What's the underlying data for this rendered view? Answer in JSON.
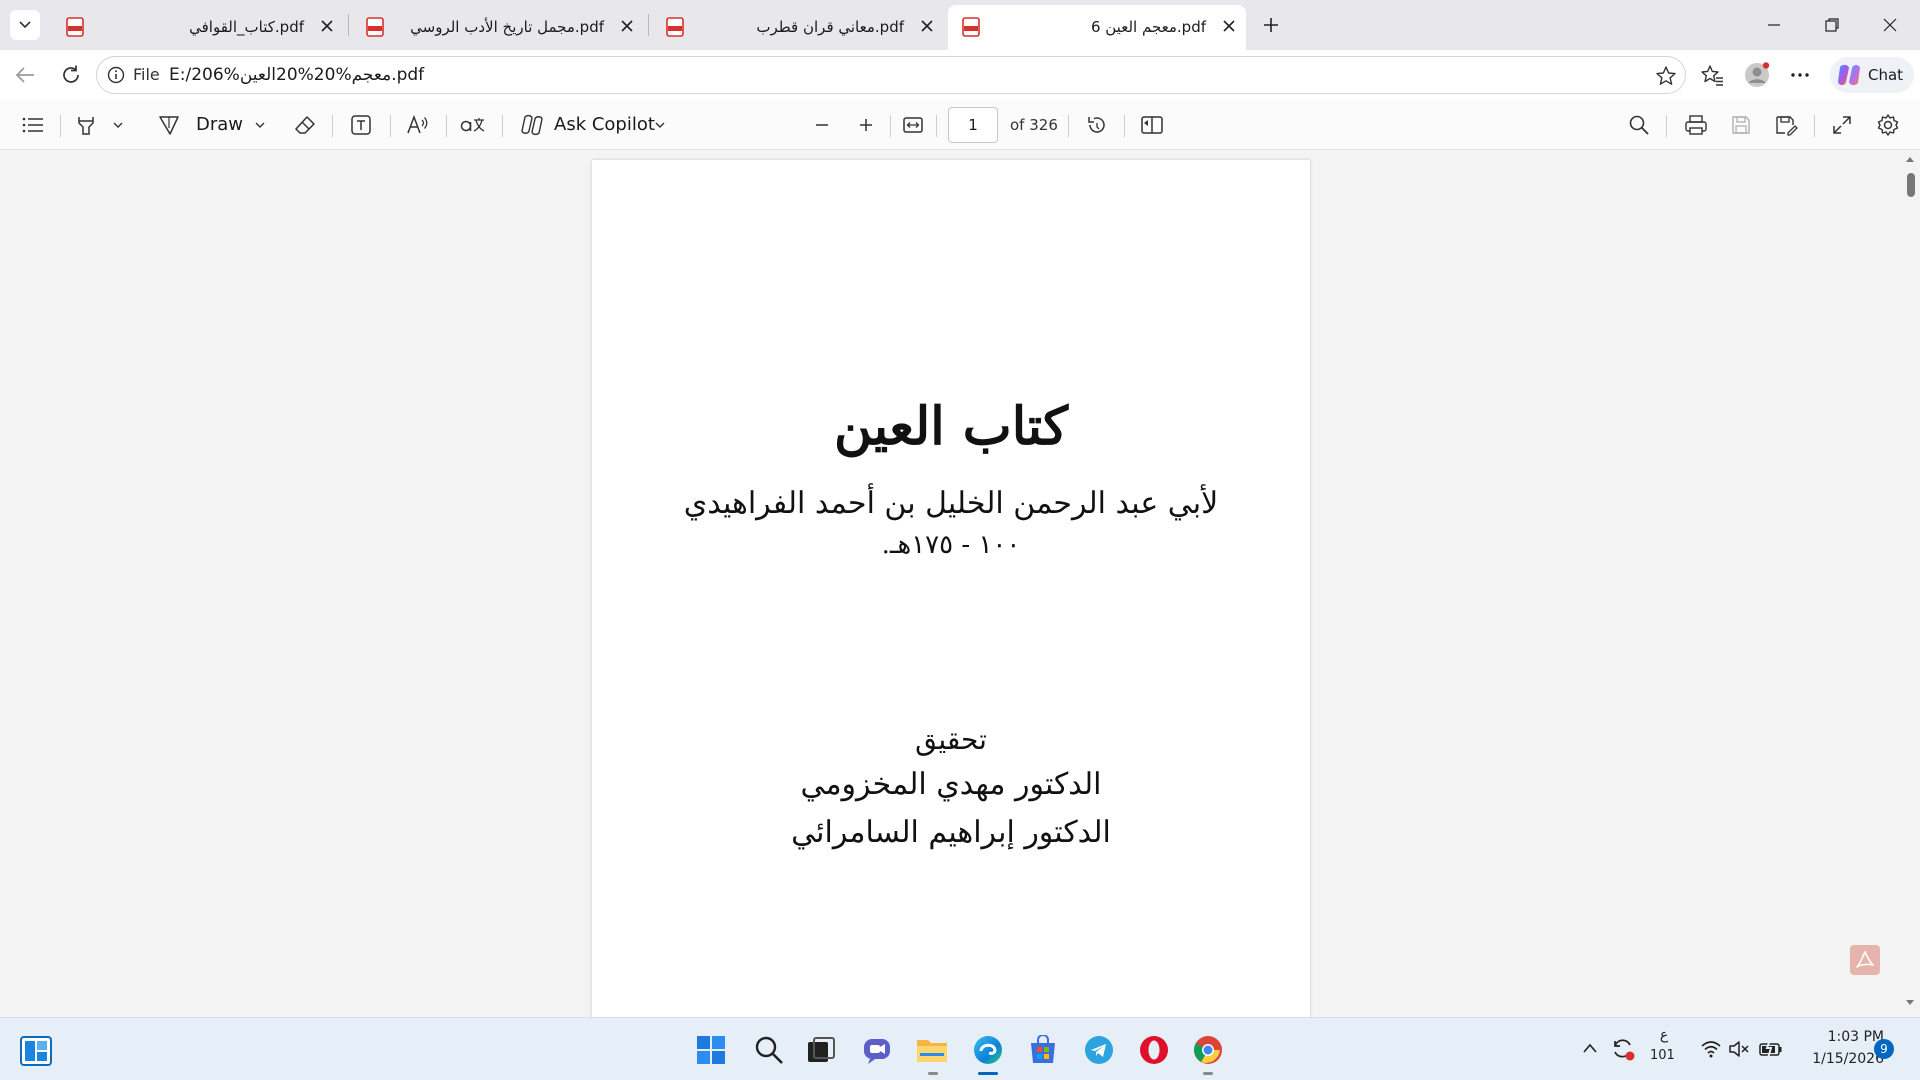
{
  "tabs": [
    {
      "title": "كتاب_القوافي.pdf",
      "active": false
    },
    {
      "title": "مجمل تاريخ الأدب الروسي.pdf",
      "active": false
    },
    {
      "title": "معاني قران قطرب.pdf",
      "active": false
    },
    {
      "title": "معجم العين 6.pdf",
      "active": true
    }
  ],
  "address": {
    "scheme_label": "File",
    "url": "E:/206%معجم%20%20العين.pdf"
  },
  "addr_actions": {
    "chat_label": "Chat"
  },
  "pdf_toolbar": {
    "draw_label": "Draw",
    "ask_copilot_label": "Ask Copilot",
    "page_number": "1",
    "page_total": "of 326"
  },
  "document": {
    "title": "كتاب العين",
    "author": "لأبي عبد الرحمن الخليل بن أحمد الفراهيدي",
    "dates": "١٠٠ - ١٧٥هـ.",
    "edited_label": "تحقيق",
    "editor1": "الدكتور مهدي المخزومي",
    "editor2": "الدكتور إبراهيم السامرائي"
  },
  "tray": {
    "ime_top": "ع",
    "ime_bottom": "101",
    "time": "1:03 PM",
    "date": "1/15/2026",
    "notification_count": "9"
  },
  "colors": {
    "accent": "#0067c0",
    "pdf_red": "#d9302c",
    "taskbar": "#e6eef7"
  },
  "icons": {
    "tab_list": "chevron-down-icon",
    "tab_file": "pdf-icon",
    "new_tab": "plus-icon",
    "back": "arrow-left-icon",
    "reload": "reload-icon",
    "site_info": "info-icon",
    "favorite": "star-icon",
    "favorites": "favorites-icon",
    "profile": "profile-icon",
    "more": "more-icon",
    "copilot": "copilot-icon"
  }
}
